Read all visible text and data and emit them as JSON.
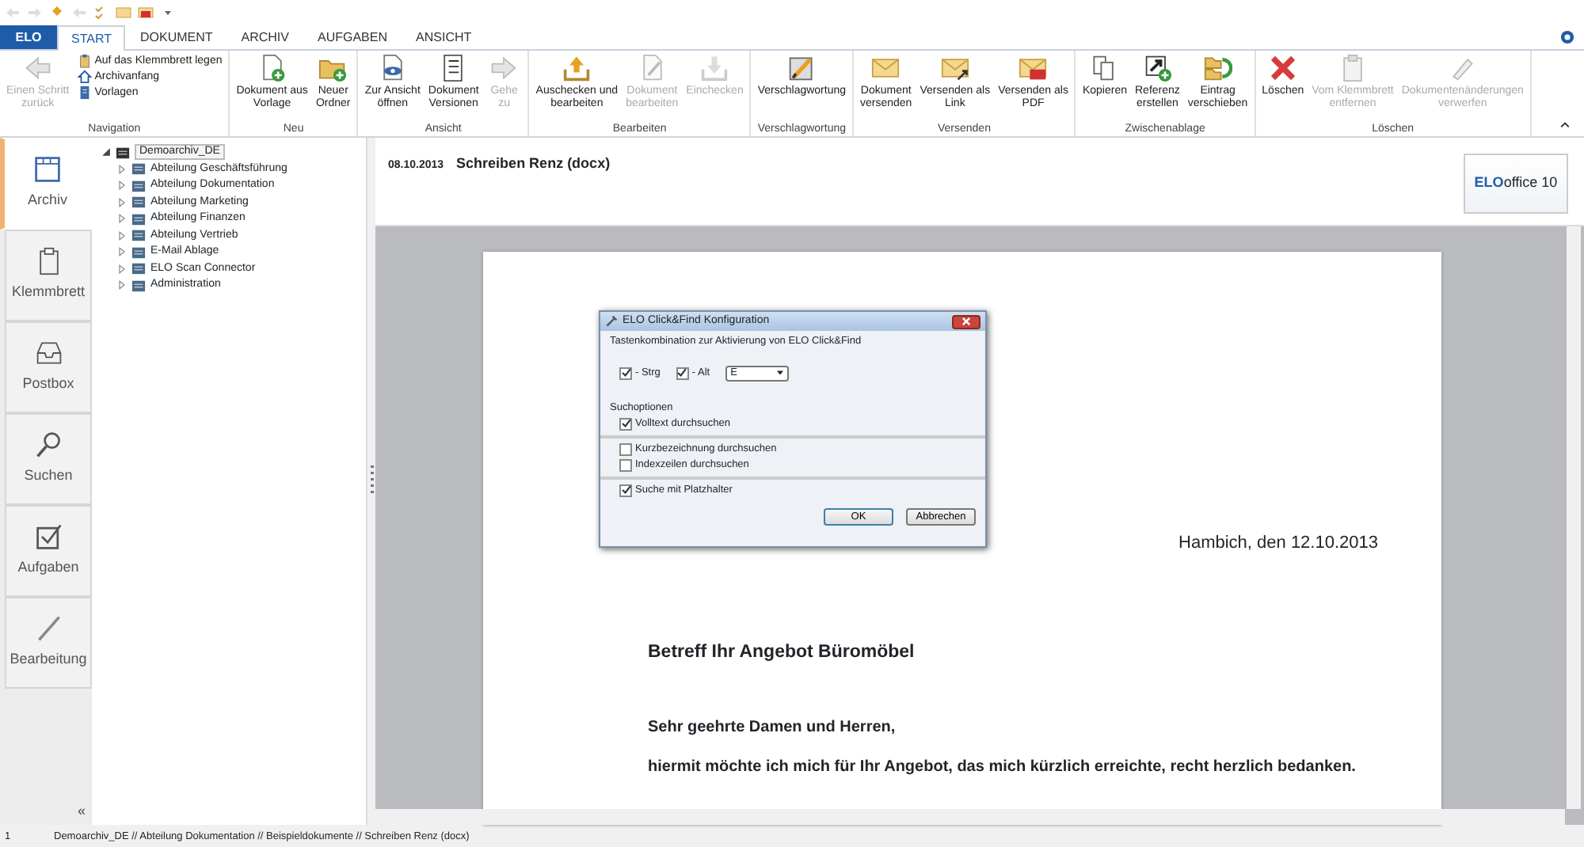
{
  "app_button": {
    "label": "ELO"
  },
  "tabs": [
    {
      "label": "START",
      "selected": true
    },
    {
      "label": "DOKUMENT",
      "selected": false
    },
    {
      "label": "ARCHIV",
      "selected": false
    },
    {
      "label": "AUFGABEN",
      "selected": false
    },
    {
      "label": "ANSICHT",
      "selected": false
    }
  ],
  "ribbon": {
    "groups": [
      {
        "label": "Navigation",
        "buttons": [
          {
            "kind": "large",
            "label": "Einen Schritt zurück",
            "disabled": true
          },
          {
            "kind": "small",
            "label": "Auf das Klemmbrett legen",
            "disabled": false
          },
          {
            "kind": "small",
            "label": "Archivanfang",
            "disabled": false
          },
          {
            "kind": "small",
            "label": "Vorlagen",
            "disabled": false
          }
        ]
      },
      {
        "label": "Neu",
        "buttons": [
          {
            "kind": "large",
            "label": "Dokument aus Vorlage",
            "disabled": false
          },
          {
            "kind": "large",
            "label": "Neuer Ordner",
            "disabled": false
          }
        ]
      },
      {
        "label": "Ansicht",
        "buttons": [
          {
            "kind": "large",
            "label": "Zur Ansicht öffnen",
            "disabled": false
          },
          {
            "kind": "large",
            "label": "Dokument Versionen",
            "disabled": false
          },
          {
            "kind": "large",
            "label": "Gehe zu",
            "disabled": true
          }
        ]
      },
      {
        "label": "Bearbeiten",
        "buttons": [
          {
            "kind": "large",
            "label": "Auschecken und bearbeiten",
            "disabled": false
          },
          {
            "kind": "large",
            "label": "Dokument bearbeiten",
            "disabled": true
          },
          {
            "kind": "large",
            "label": "Einchecken",
            "disabled": true
          }
        ]
      },
      {
        "label": "Verschlagwortung",
        "buttons": [
          {
            "kind": "large",
            "label": "Verschlagwortung",
            "disabled": false
          }
        ]
      },
      {
        "label": "Versenden",
        "buttons": [
          {
            "kind": "large",
            "label": "Dokument versenden",
            "disabled": false
          },
          {
            "kind": "large",
            "label": "Versenden als Link",
            "disabled": false
          },
          {
            "kind": "large",
            "label": "Versenden als PDF",
            "disabled": false
          }
        ]
      },
      {
        "label": "Zwischenablage",
        "buttons": [
          {
            "kind": "large",
            "label": "Kopieren",
            "disabled": false
          },
          {
            "kind": "large",
            "label": "Referenz erstellen",
            "disabled": false
          },
          {
            "kind": "large",
            "label": "Eintrag verschieben",
            "disabled": false
          }
        ]
      },
      {
        "label": "Löschen",
        "buttons": [
          {
            "kind": "large",
            "label": "Löschen",
            "disabled": false
          },
          {
            "kind": "large",
            "label": "Vom Klemmbrett entfernen",
            "disabled": true
          },
          {
            "kind": "large",
            "label": "Dokumentenänderungen verwerfen",
            "disabled": true
          }
        ]
      }
    ]
  },
  "nav": {
    "items": [
      {
        "label": "Archiv",
        "selected": true
      },
      {
        "label": "Klemmbrett",
        "selected": false
      },
      {
        "label": "Postbox",
        "selected": false
      },
      {
        "label": "Suchen",
        "selected": false
      },
      {
        "label": "Aufgaben",
        "selected": false
      },
      {
        "label": "Bearbeitung",
        "selected": false
      }
    ],
    "collapse_label": "«"
  },
  "tree": {
    "label": "Demoarchiv_DE",
    "expanded": true,
    "selected": true,
    "children": [
      {
        "label": "Abteilung Geschäftsführung"
      },
      {
        "label": "Abteilung Dokumentation"
      },
      {
        "label": "Abteilung Marketing"
      },
      {
        "label": "Abteilung Finanzen"
      },
      {
        "label": "Abteilung Vertrieb"
      },
      {
        "label": "E-Mail Ablage"
      },
      {
        "label": "ELO Scan Connector"
      },
      {
        "label": "Administration"
      }
    ]
  },
  "document": {
    "date": "08.10.2013",
    "title": "Schreiben Renz (docx)",
    "logo_brand": "ELO",
    "logo_product": "office 10",
    "page_lines": [
      {
        "kind": "place",
        "text": "Hambich, den 12.10.2013"
      },
      {
        "kind": "subject",
        "text": "Betreff Ihr Angebot Büromöbel"
      },
      {
        "kind": "body",
        "text": "Sehr geehrte Damen und Herren,"
      },
      {
        "kind": "body",
        "text": "hiermit möchte ich mich für Ihr Angebot, das mich kürzlich erreichte, recht herzlich bedanken."
      }
    ]
  },
  "dialog": {
    "title": "ELO Click&Find Konfiguration",
    "instruction": "Tastenkombination zur Aktivierung von ELO Click&Find",
    "modifiers": [
      {
        "label": "- Strg",
        "checked": true
      },
      {
        "label": "- Alt",
        "checked": true
      }
    ],
    "key": "E",
    "section": "Suchoptionen",
    "options": [
      {
        "label": "Volltext durchsuchen",
        "checked": true,
        "separator_after": true
      },
      {
        "label": "Kurzbezeichnung durchsuchen",
        "checked": false,
        "separator_after": false
      },
      {
        "label": "Indexzeilen durchsuchen",
        "checked": false,
        "separator_after": true
      },
      {
        "label": "Suche mit Platzhalter",
        "checked": true,
        "separator_after": false
      }
    ],
    "buttons": [
      {
        "label": "OK",
        "default": true
      },
      {
        "label": "Abbrechen",
        "default": false
      }
    ]
  },
  "status_bar": {
    "count": "1",
    "path": "Demoarchiv_DE // Abteilung Dokumentation // Beispieldokumente // Schreiben Renz (docx)"
  }
}
